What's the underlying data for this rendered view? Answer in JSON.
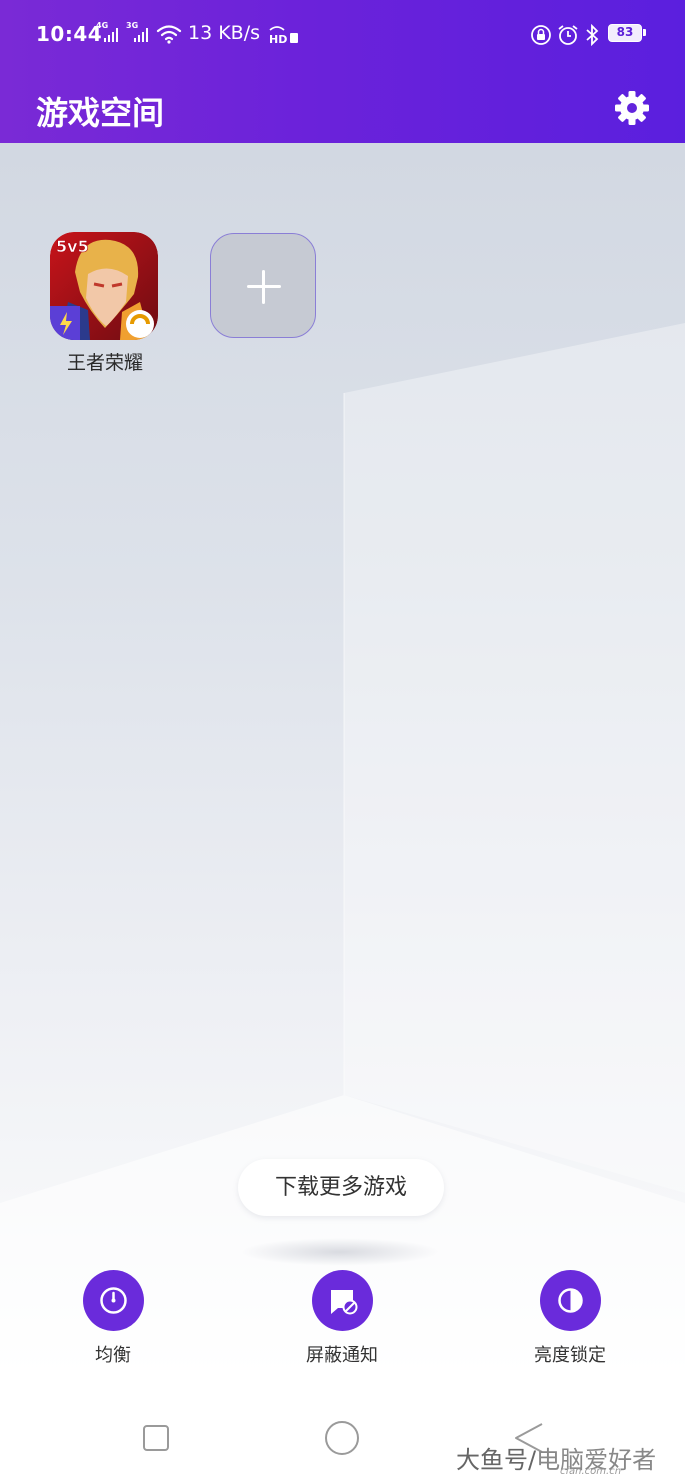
{
  "status_bar": {
    "time": "10:44",
    "signal1_tag": "4G",
    "signal2_tag": "3G",
    "net_speed": "13 KB/s",
    "hd_label": "HD",
    "battery": "83",
    "icons": [
      "signal-icon",
      "wifi-icon",
      "hd-icon",
      "vpn-lock-icon",
      "alarm-icon",
      "bluetooth-icon",
      "battery-icon"
    ]
  },
  "app_bar": {
    "title": "游戏空间",
    "settings_icon": "gear-icon"
  },
  "games": [
    {
      "label": "王者荣耀",
      "icon_text": "5v5"
    }
  ],
  "add_game_icon": "plus-icon",
  "download_button": "下载更多游戏",
  "quick_actions": [
    {
      "label": "均衡",
      "icon": "gauge-icon"
    },
    {
      "label": "屏蔽通知",
      "icon": "block-notification-icon"
    },
    {
      "label": "亮度锁定",
      "icon": "brightness-icon"
    }
  ],
  "nav_bar": {
    "icons": [
      "recent-apps-icon",
      "home-icon",
      "back-icon"
    ]
  },
  "watermark": {
    "text_a": "大鱼号/",
    "text_b": "电脑爱好者",
    "text_c": "cfan.com.cn"
  },
  "colors": {
    "header_purple": "#6b22da",
    "action_purple": "#6a2bdb",
    "background": "#dde2ea"
  }
}
